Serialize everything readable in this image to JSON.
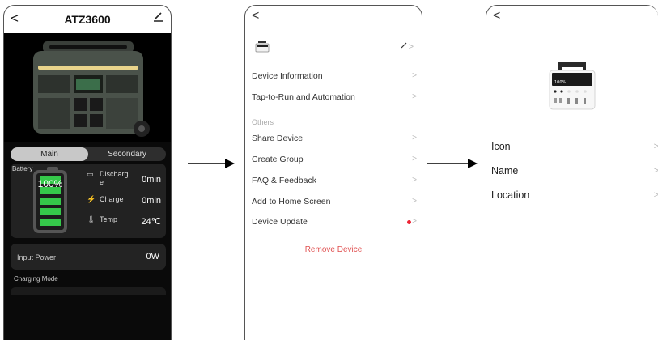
{
  "screen1": {
    "back_glyph": "<",
    "title": "ATZ3600",
    "tabs": {
      "main": "Main",
      "secondary": "Secondary"
    },
    "battery": {
      "label": "Battery",
      "percent": "100%",
      "level": 1.0,
      "discharge_label": "Discharg\ne",
      "discharge_value": "0min",
      "charge_label": "Charge",
      "charge_value": "0min",
      "temp_label": "Temp",
      "temp_value": "24℃"
    },
    "input_power": {
      "label": "Input Power",
      "value": "0W"
    },
    "charging_mode_label": "Charging Mode",
    "colors": {
      "battery_green": "#35c84a",
      "background": "#0a0a0a"
    }
  },
  "screen2": {
    "back_glyph": "<",
    "menu_items": [
      {
        "label": "Device Information",
        "chevron": ">"
      },
      {
        "label": "Tap-to-Run and Automation",
        "chevron": ">"
      }
    ],
    "others_label": "Others",
    "others_items": [
      {
        "label": "Share Device",
        "chevron": ">"
      },
      {
        "label": "Create Group",
        "chevron": ">"
      },
      {
        "label": "FAQ & Feedback",
        "chevron": ">"
      },
      {
        "label": "Add to Home Screen",
        "chevron": ">"
      },
      {
        "label": "Device Update",
        "chevron": ">"
      }
    ],
    "remove_label": "Remove Device",
    "colors": {
      "remove": "#e05050",
      "update_dot": "#e22233"
    }
  },
  "screen3": {
    "back_glyph": "<",
    "device_screen_text": "100%",
    "items": [
      {
        "label": "Icon",
        "chevron": ">"
      },
      {
        "label": "Name",
        "chevron": ">"
      },
      {
        "label": "Location",
        "chevron": ">"
      }
    ]
  }
}
